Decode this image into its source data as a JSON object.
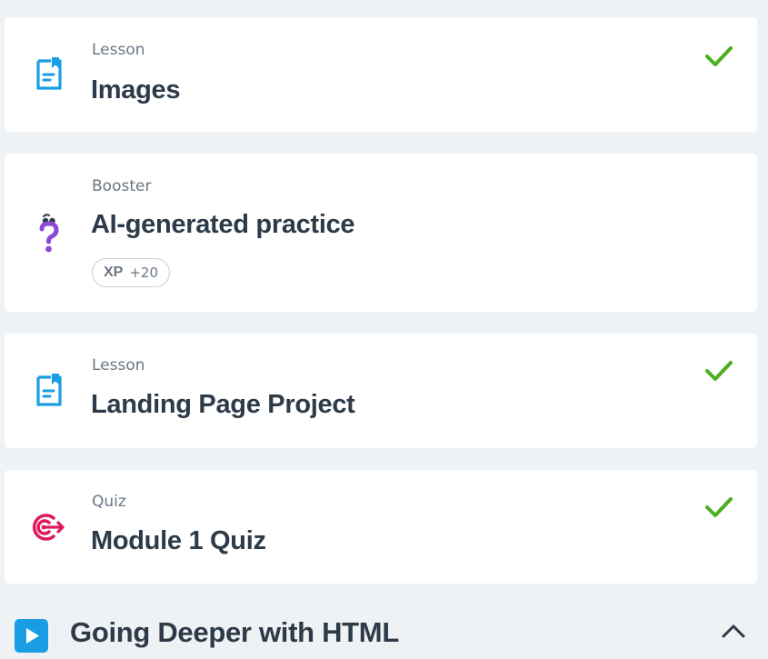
{
  "items": [
    {
      "type": "Lesson",
      "title": "Images",
      "icon": "lesson-doc-icon",
      "completed": true
    },
    {
      "type": "Booster",
      "title": "AI-generated practice",
      "icon": "question-mark-icon",
      "xp_label": "XP",
      "xp_value": "+20",
      "completed": false
    },
    {
      "type": "Lesson",
      "title": "Landing Page Project",
      "icon": "lesson-doc-icon",
      "completed": true
    },
    {
      "type": "Quiz",
      "title": "Module 1 Quiz",
      "icon": "target-icon",
      "completed": true
    }
  ],
  "module": {
    "title": "Going Deeper with HTML",
    "icon": "play-icon",
    "expanded": true
  },
  "colors": {
    "background": "#eff2f5",
    "card": "#ffffff",
    "lesson_icon": "#1a9ee3",
    "booster_icon": "#8b4bd8",
    "quiz_icon": "#e0195a",
    "check": "#4caf1e",
    "title_text": "#2d3a48",
    "meta_text": "#6b7785"
  }
}
